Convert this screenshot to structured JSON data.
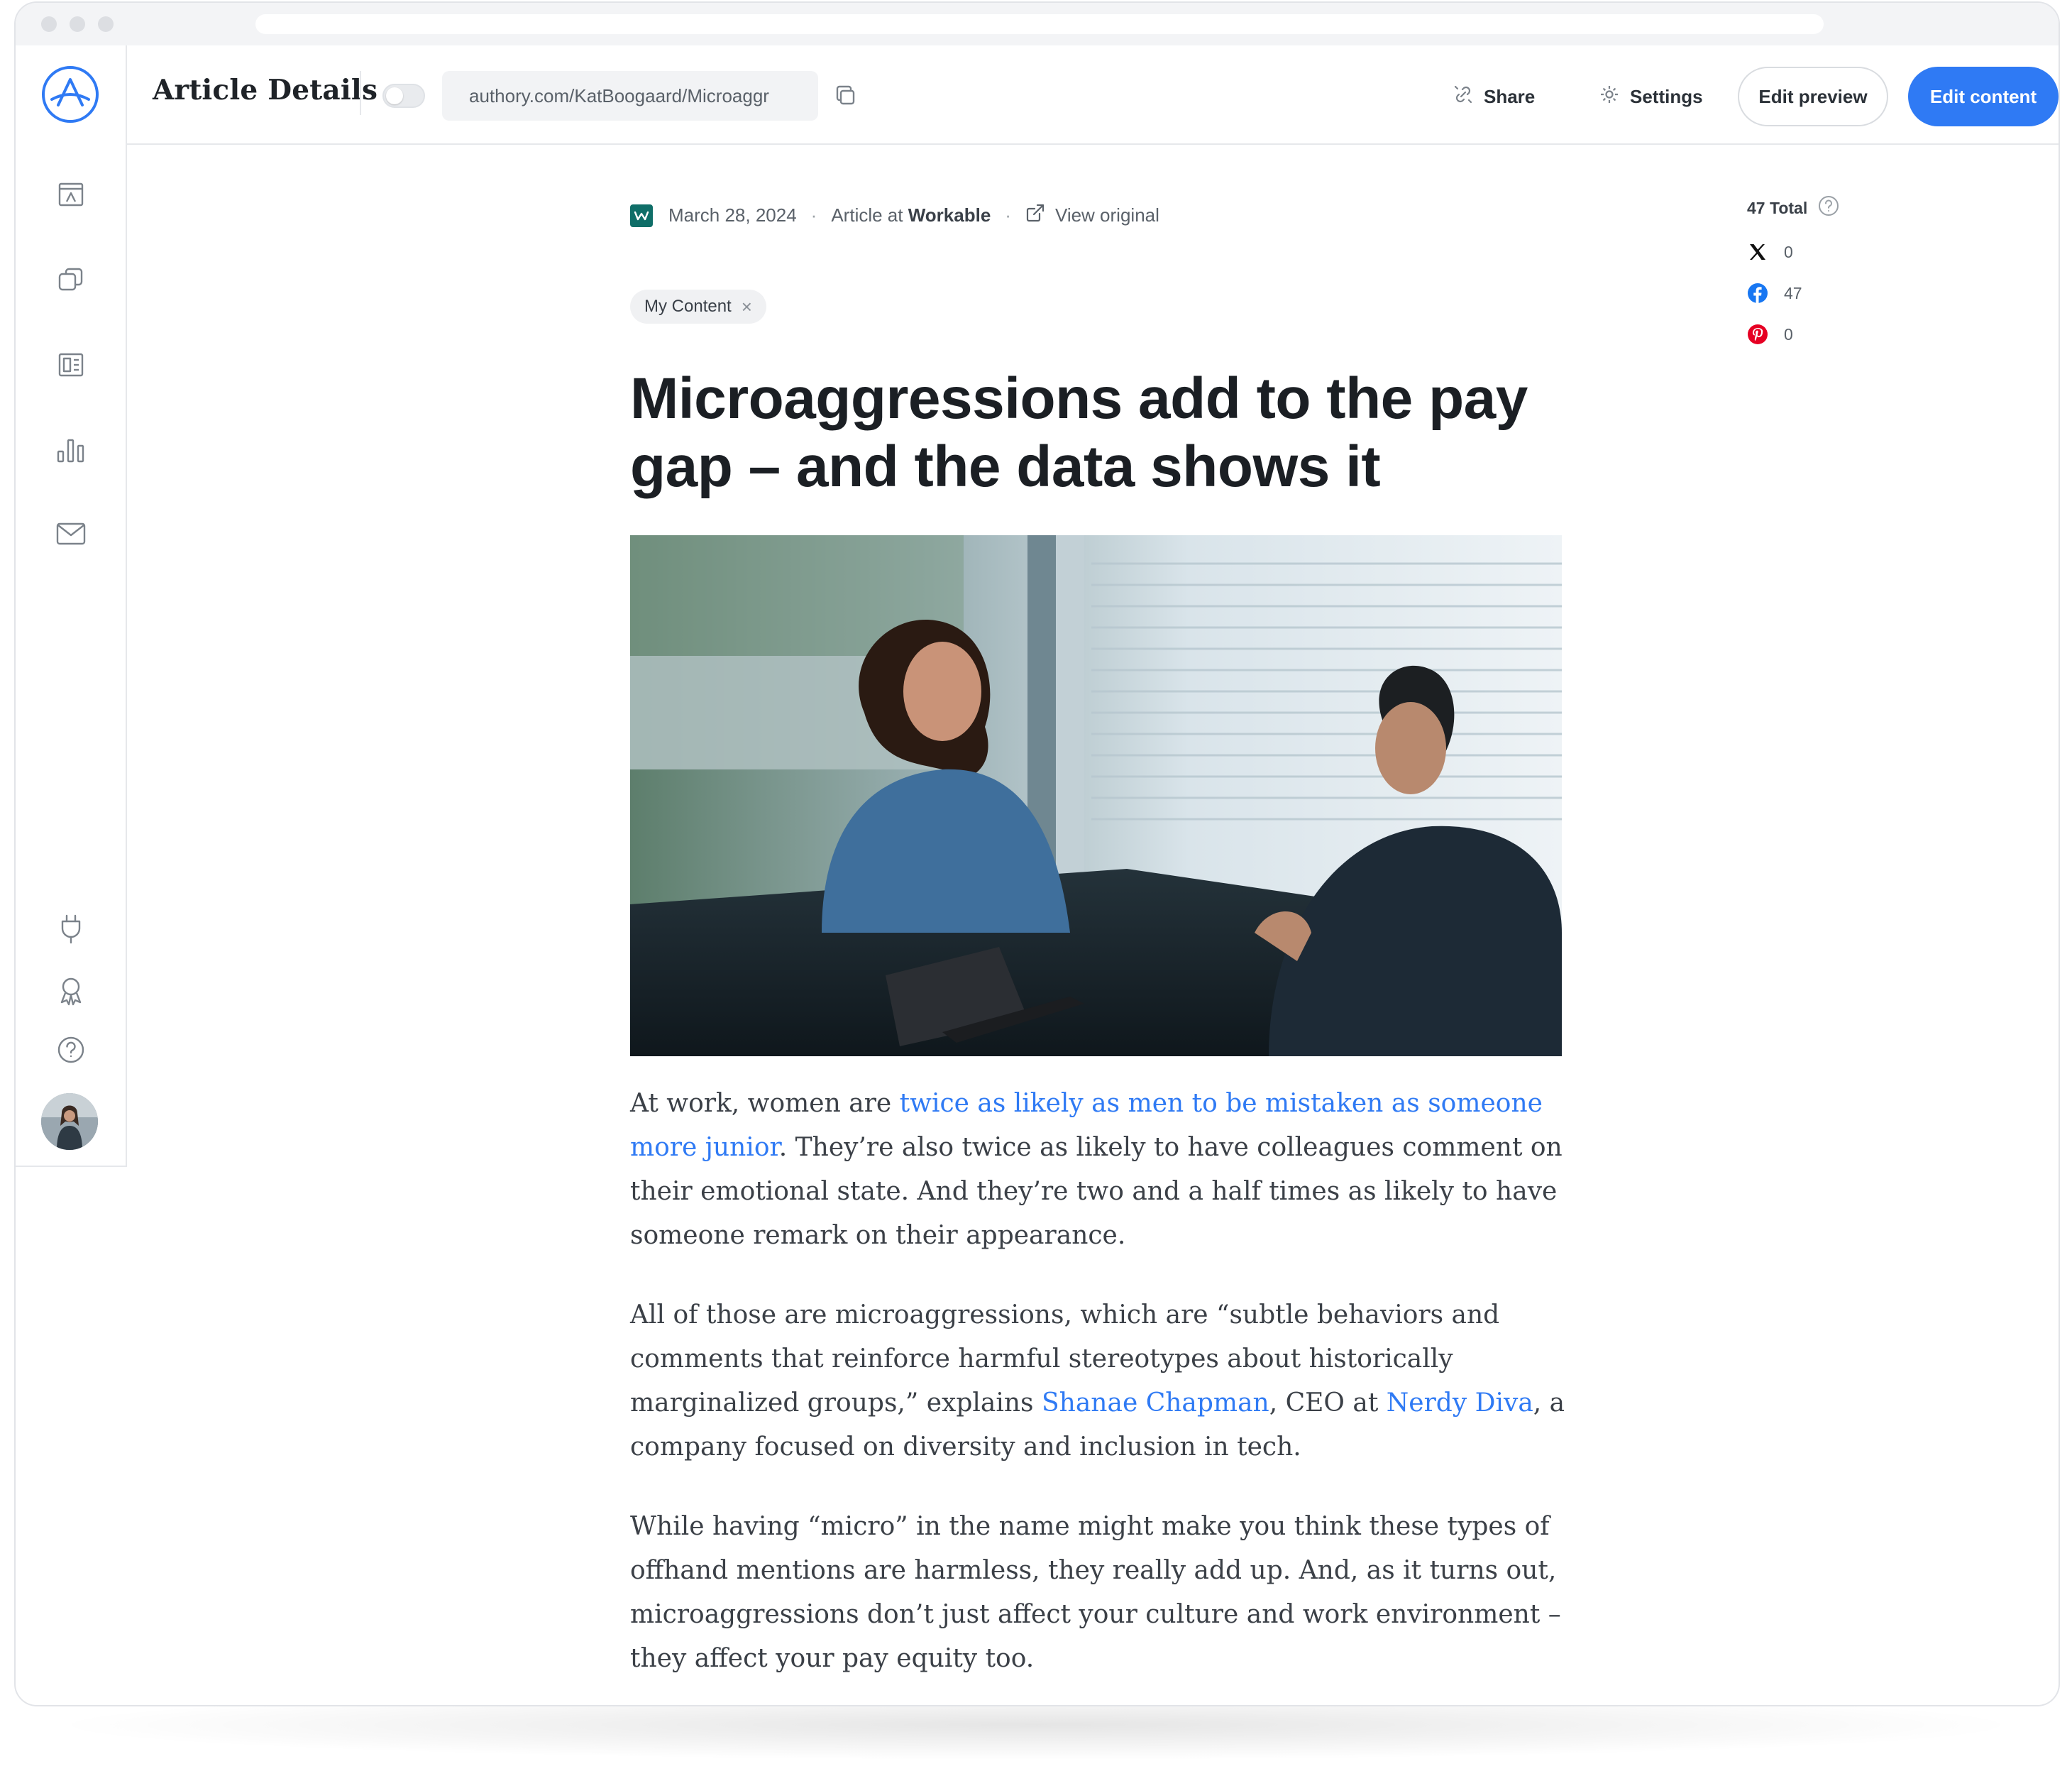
{
  "header": {
    "title": "Article Details",
    "url": "authory.com/KatBoogaard/Microaggr",
    "share_label": "Share",
    "settings_label": "Settings",
    "edit_preview_label": "Edit preview",
    "edit_content_label": "Edit content"
  },
  "article": {
    "date": "March 28, 2024",
    "type_prefix": "Article at ",
    "publication": "Workable",
    "view_original_label": "View original",
    "tag": "My Content",
    "title": "Microaggressions add to the pay gap – and the data shows it",
    "paragraphs": [
      {
        "p1_start": "At work, women are ",
        "p1_link": "twice as likely as men to be mistaken as someone more junior",
        "p1_end": ". They’re also twice as likely to have colleagues comment on their emotional state. And they’re two and a half times as likely to have someone remark on their appearance."
      },
      {
        "p2_start": "All of those are microaggressions, which are “subtle behaviors and comments that reinforce harmful stereotypes about historically marginalized groups,” explains ",
        "p2_link1": "Shanae Chapman",
        "p2_mid": ", CEO at ",
        "p2_link2": "Nerdy Diva",
        "p2_end": ", a company focused on diversity and inclusion in tech."
      },
      {
        "p3": "While having “micro” in the name might make you think these types of offhand mentions are harmless, they really add up. And, as it turns out, microaggressions don’t just affect your culture and work environment – they affect your pay equity too."
      }
    ]
  },
  "stats": {
    "total_label": "47 Total",
    "items": [
      {
        "network": "x-icon",
        "count": "0"
      },
      {
        "network": "facebook-icon",
        "count": "47"
      },
      {
        "network": "pinterest-icon",
        "count": "0"
      }
    ]
  },
  "colors": {
    "accent": "#2f7af4",
    "link": "#2f7af4",
    "facebook": "#1877f2",
    "pinterest": "#e60023"
  }
}
